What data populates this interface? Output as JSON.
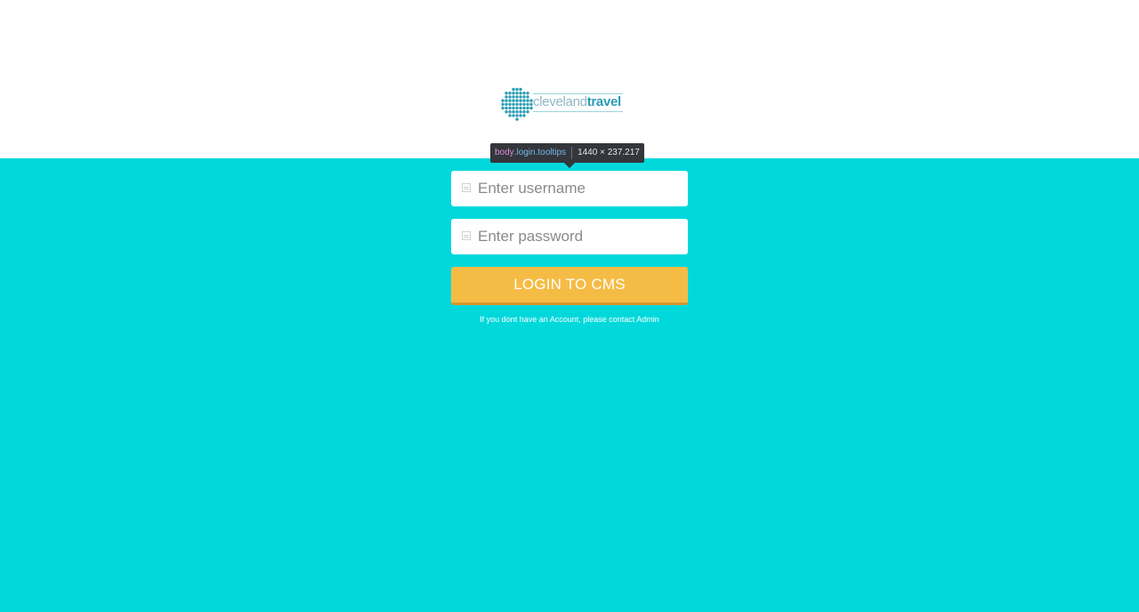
{
  "brand": {
    "logo_text_light": "cleveland",
    "logo_text_bold": "travel",
    "logo_dot_color": "#2b9db5"
  },
  "devtools_tooltip": {
    "tag": "body",
    "classes": ".login.tooltips",
    "dimensions": "1440 × 237.217"
  },
  "login": {
    "username_placeholder": "Enter username",
    "password_placeholder": "Enter password",
    "submit_label": "LOGIN TO CMS",
    "note": "If you dont have an Account, please contact Admin"
  },
  "colors": {
    "background_accent": "#00d8db",
    "button": "#f5bc45",
    "button_border": "#d9962a"
  }
}
